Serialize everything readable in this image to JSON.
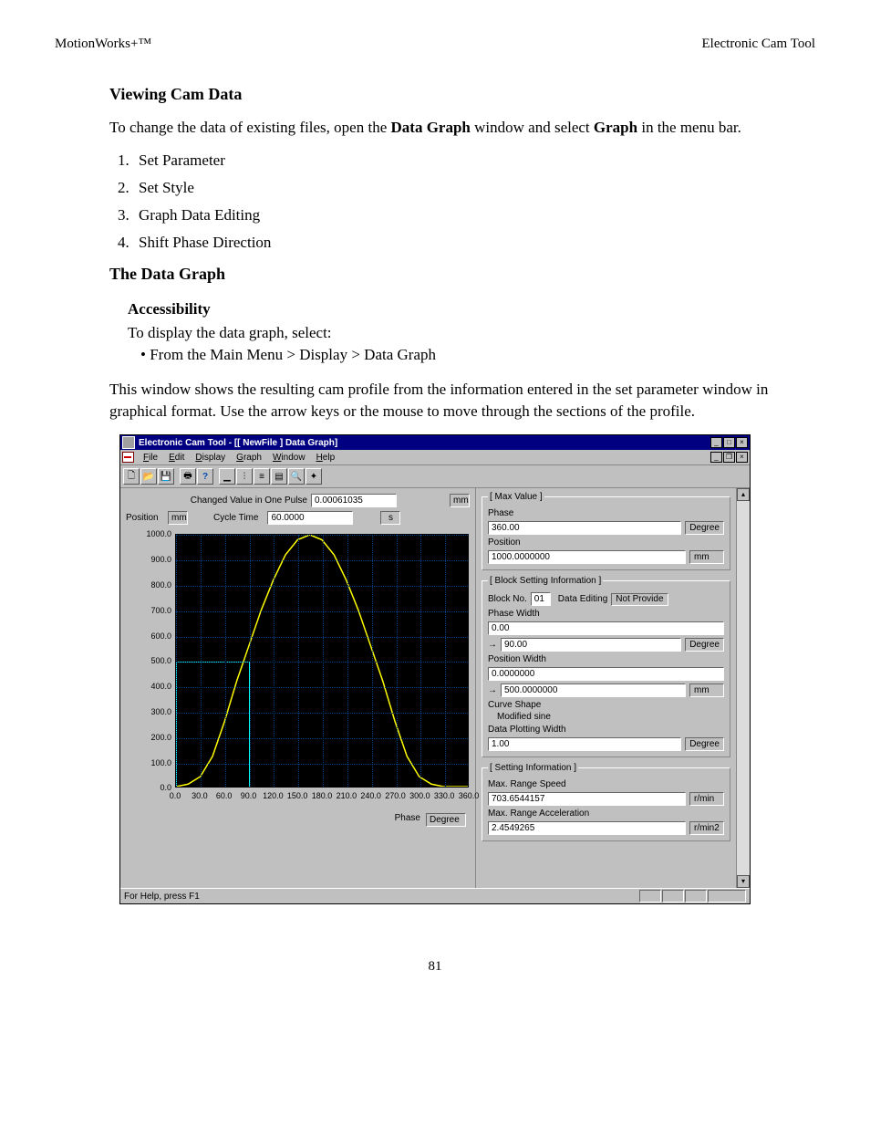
{
  "header": {
    "left": "MotionWorks+™",
    "right": "Electronic Cam Tool"
  },
  "h_viewing": "Viewing Cam Data",
  "para_intro_a": "To change the data of existing files, open the ",
  "para_intro_b": "Data Graph",
  "para_intro_c": " window and select ",
  "para_intro_d": "Graph",
  "para_intro_e": " in the menu bar.",
  "list": {
    "i1": "Set Parameter",
    "i2": "Set Style",
    "i3": "Graph Data Editing",
    "i4": "Shift Phase Direction"
  },
  "h_datagraph": "The Data Graph",
  "h_access": "Accessibility",
  "access_line": "To display the data graph, select:",
  "access_bullet": "• From the Main Menu > Display > Data Graph",
  "para_window": "This window shows the resulting cam profile from the information entered in the set parameter window in graphical format.  Use the arrow keys or the mouse to move through the sections of the profile.",
  "page_number": "81",
  "app": {
    "title": "Electronic Cam Tool - [[ NewFile ] Data Graph]",
    "menus": {
      "file": "File",
      "edit": "Edit",
      "display": "Display",
      "graph": "Graph",
      "window": "Window",
      "help": "Help"
    },
    "status": "For Help, press F1",
    "left": {
      "position_label": "Position",
      "position_unit": "mm",
      "changed_label": "Changed Value in One Pulse",
      "changed_value": "0.00061035",
      "changed_unit": "mm",
      "cycle_label": "Cycle Time",
      "cycle_value": "60.0000",
      "cycle_unit": "s",
      "phase_label": "Phase",
      "phase_unit": "Degree"
    },
    "max": {
      "legend": "[ Max Value ]",
      "phase_label": "Phase",
      "phase_value": "360.00",
      "phase_unit": "Degree",
      "position_label": "Position",
      "position_value": "1000.0000000",
      "position_unit": "mm"
    },
    "block": {
      "legend": "[ Block Setting Information ]",
      "blockno_label": "Block No.",
      "blockno_value": "01",
      "dataedit_label": "Data Editing",
      "dataedit_value": "Not Provide",
      "phasewidth_label": "Phase Width",
      "phasewidth_from": "0.00",
      "phasewidth_to": "90.00",
      "phasewidth_unit": "Degree",
      "poswidth_label": "Position Width",
      "poswidth_from": "0.0000000",
      "poswidth_to": "500.0000000",
      "poswidth_unit": "mm",
      "curve_label": "Curve Shape",
      "curve_value": "Modified sine",
      "plot_label": "Data Plotting Width",
      "plot_value": "1.00",
      "plot_unit": "Degree"
    },
    "setting": {
      "legend": "[ Setting Information ]",
      "speed_label": "Max. Range Speed",
      "speed_value": "703.6544157",
      "speed_unit": "r/min",
      "accel_label": "Max. Range Acceleration",
      "accel_value": "2.4549265",
      "accel_unit": "r/min2"
    }
  },
  "chart_data": {
    "type": "line",
    "title": "",
    "xlabel": "Phase",
    "ylabel": "Position",
    "xunit": "Degree",
    "yunit": "mm",
    "xlim": [
      0,
      360
    ],
    "ylim": [
      0,
      1000
    ],
    "xticks": [
      0,
      30,
      60,
      90,
      120,
      150,
      180,
      210,
      240,
      270,
      300,
      330,
      360
    ],
    "yticks": [
      0,
      100,
      200,
      300,
      400,
      500,
      600,
      700,
      800,
      900,
      1000
    ],
    "xtick_labels": [
      "0.0",
      "30.0",
      "60.0",
      "90.0",
      "120.0",
      "150.0",
      "180.0",
      "210.0",
      "240.0",
      "270.0",
      "300.0",
      "330.0",
      "360.0"
    ],
    "ytick_labels": [
      "0.0",
      "100.0",
      "200.0",
      "300.0",
      "400.0",
      "500.0",
      "600.0",
      "700.0",
      "800.0",
      "900.0",
      "1000.0"
    ],
    "series": [
      {
        "name": "Modified sine cam profile",
        "color": "#ffff00",
        "x": [
          0,
          15,
          30,
          45,
          60,
          75,
          90,
          105,
          120,
          135,
          150,
          165,
          180,
          195,
          210,
          225,
          240,
          255,
          270,
          285,
          300,
          315,
          330,
          345,
          360
        ],
        "y": [
          0,
          10,
          40,
          120,
          260,
          420,
          560,
          700,
          820,
          920,
          980,
          1000,
          980,
          920,
          820,
          700,
          560,
          420,
          260,
          120,
          40,
          10,
          0,
          0,
          0
        ]
      }
    ],
    "selection_block": {
      "x_from": 0,
      "x_to": 90,
      "y_from": 0,
      "y_to": 500
    }
  }
}
